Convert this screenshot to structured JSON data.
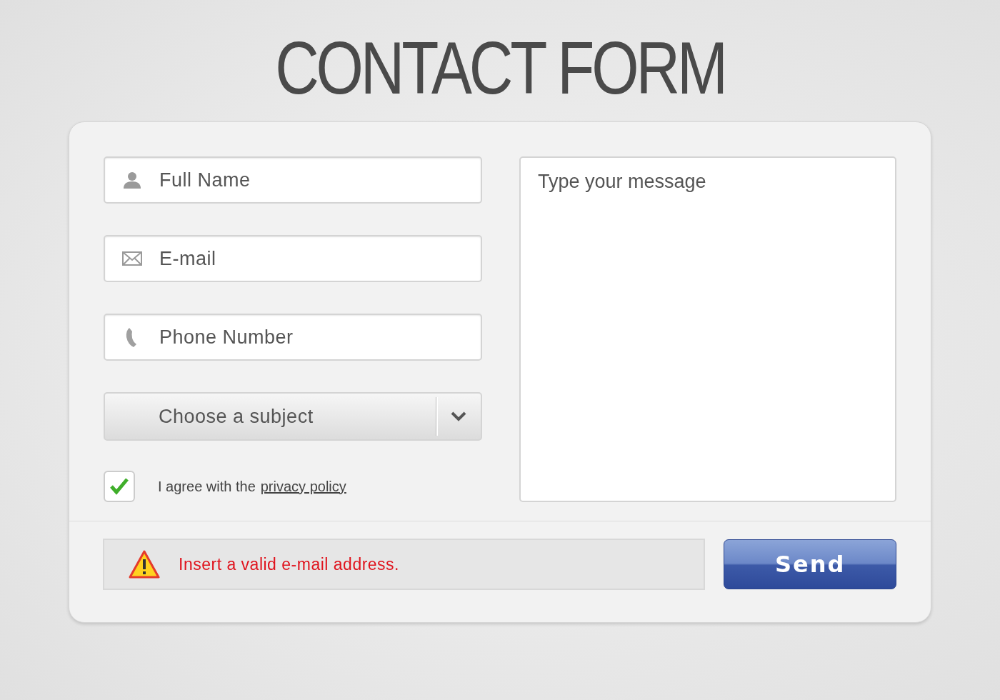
{
  "title": "CONTACT FORM",
  "fields": [
    {
      "kind": "name",
      "placeholder": "Full Name"
    },
    {
      "kind": "email",
      "placeholder": "E-mail"
    },
    {
      "kind": "phone",
      "placeholder": "Phone Number"
    }
  ],
  "subject": {
    "placeholder": "Choose a subject"
  },
  "agreement": {
    "checked": true,
    "text": "I agree with the",
    "link": "privacy policy"
  },
  "message": {
    "placeholder": "Type your message"
  },
  "error": {
    "text": "Insert a valid e-mail address."
  },
  "send_button": "Send"
}
